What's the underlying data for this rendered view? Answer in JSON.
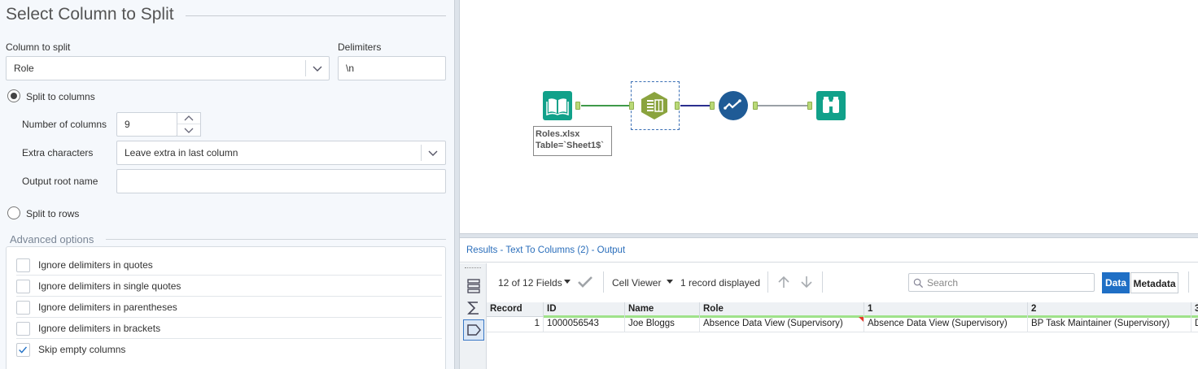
{
  "config": {
    "title": "Select Column to Split",
    "column_to_split_label": "Column to split",
    "column_to_split_value": "Role",
    "delimiters_label": "Delimiters",
    "delimiters_value": "\\n",
    "split_to_columns_label": "Split to columns",
    "split_to_columns_selected": true,
    "number_of_columns_label": "Number of columns",
    "number_of_columns_value": "9",
    "extra_characters_label": "Extra characters",
    "extra_characters_value": "Leave extra in last column",
    "output_root_name_label": "Output root name",
    "output_root_name_value": "",
    "split_to_rows_label": "Split to rows",
    "split_to_rows_selected": false,
    "advanced_title": "Advanced options",
    "advanced_options": [
      {
        "label": "Ignore delimiters in quotes",
        "checked": false
      },
      {
        "label": "Ignore delimiters in single quotes",
        "checked": false
      },
      {
        "label": "Ignore delimiters in parentheses",
        "checked": false
      },
      {
        "label": "Ignore delimiters in brackets",
        "checked": false
      },
      {
        "label": "Skip empty columns",
        "checked": true
      }
    ]
  },
  "canvas": {
    "annotation_line1": "Roles.xlsx",
    "annotation_line2": "Table=`Sheet1$`",
    "tools": [
      "input-data-icon",
      "text-to-columns-icon",
      "select-records-icon",
      "browse-icon"
    ]
  },
  "results": {
    "title": "Results - Text To Columns (2) - Output",
    "fields_label": "12 of 12 Fields",
    "cell_viewer_label": "Cell Viewer",
    "records_label": "1 record displayed",
    "search_placeholder": "Search",
    "data_tab": "Data",
    "metadata_tab": "Metadata",
    "columns": [
      "Record",
      "ID",
      "Name",
      "Role",
      "1",
      "2",
      "3"
    ],
    "rows": [
      [
        "1",
        "1000056543",
        "Joe Bloggs",
        "Absence Data View (Supervisory)",
        "Absence Data View (Supervisory)",
        "BP Task Maintainer (Supervisory)",
        "D"
      ]
    ]
  },
  "colors": {
    "accent": "#1f6fc5",
    "tool_teal": "#11a18a",
    "tool_olive": "#8aa33e",
    "tool_blue": "#1f5b96"
  }
}
